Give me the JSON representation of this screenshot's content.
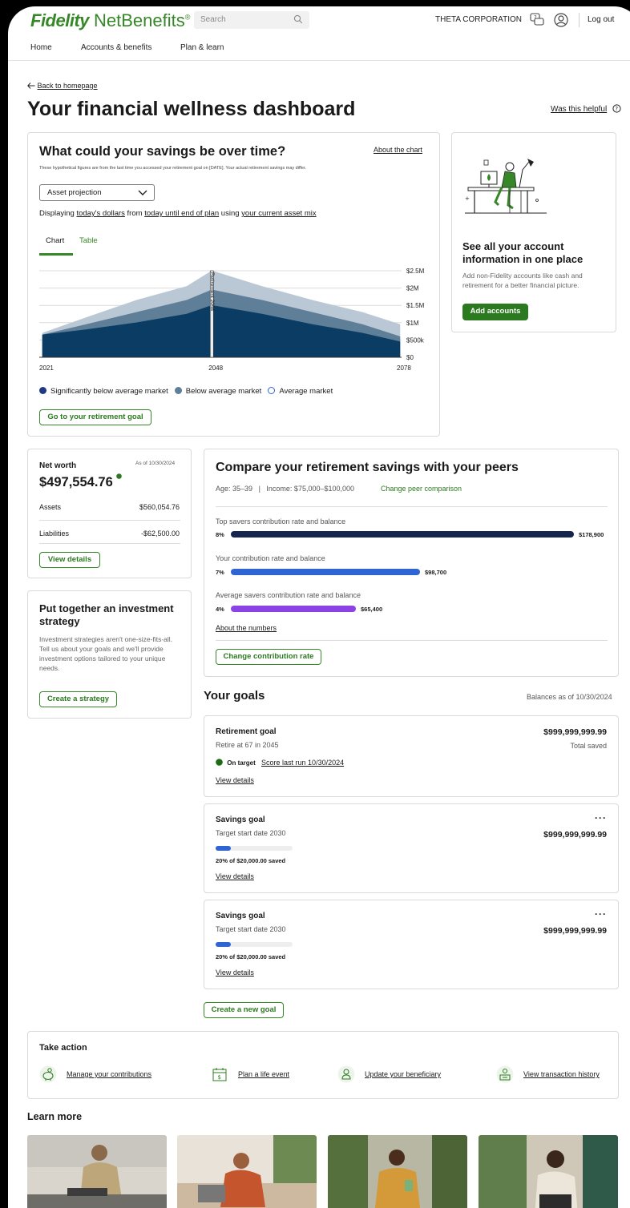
{
  "header": {
    "logo_brand": "Fidelity",
    "logo_product": "NetBenefits",
    "logo_mark": "®",
    "search_placeholder": "Search",
    "company": "THETA CORPORATION",
    "logout": "Log out"
  },
  "nav": [
    "Home",
    "Accounts & benefits",
    "Plan & learn"
  ],
  "page": {
    "back_link": "Back to homepage",
    "title": "Your financial wellness dashboard",
    "helpful": "Was this helpful"
  },
  "projection": {
    "title": "What could your savings be over time?",
    "about": "About the chart",
    "subtitle": "These hypothetical figures are from the last time you accessed your retirement goal on [DATE]. Your actual retirement savings may differ.",
    "select_value": "Asset projection",
    "displaying_prefix": "Displaying",
    "displaying_dollars": "today's dollars",
    "displaying_from": "from",
    "displaying_range": "today until end of plan",
    "displaying_using": "using",
    "displaying_mix": "your current asset mix",
    "tab_chart": "Chart",
    "tab_table": "Table",
    "cta": "Go to your retirement goal"
  },
  "chart_data": {
    "type": "area",
    "x_ticks": [
      "2021",
      "2048",
      "2078"
    ],
    "y_ticks": [
      "$2.5M",
      "$2M",
      "$1.5M",
      "$1M",
      "$500k",
      "$0"
    ],
    "ylim": [
      0,
      2500000
    ],
    "xlim": [
      2021,
      2078
    ],
    "marker_label": "Retirement 2048",
    "marker_x": 2048,
    "x": [
      2021,
      2028,
      2036,
      2044,
      2048,
      2056,
      2064,
      2072,
      2078
    ],
    "series": [
      {
        "name": "Average market",
        "color": "#b9c8d4",
        "values": [
          700000,
          1150000,
          1650000,
          2050000,
          2500000,
          2050000,
          1650000,
          1300000,
          950000
        ]
      },
      {
        "name": "Below average market",
        "color": "#5f7e98",
        "values": [
          650000,
          950000,
          1300000,
          1650000,
          1950000,
          1650000,
          1300000,
          950000,
          600000
        ]
      },
      {
        "name": "Significantly below average market",
        "color": "#0b3c63",
        "values": [
          650000,
          800000,
          1000000,
          1250000,
          1500000,
          1250000,
          950000,
          700000,
          450000
        ]
      }
    ],
    "legend": [
      {
        "label": "Significantly below average market",
        "color": "#1f3a82",
        "filled": true
      },
      {
        "label": "Below average market",
        "color": "#5f7e98",
        "filled": true
      },
      {
        "label": "Average market",
        "color": "#2f64d4",
        "filled": false
      }
    ],
    "grid": true
  },
  "promo": {
    "title": "See all your account information in one place",
    "text": "Add non-Fidelity accounts like cash and retirement for a better financial picture.",
    "button": "Add accounts"
  },
  "networth": {
    "label": "Net worth",
    "asof": "As of 10/30/2024",
    "value": "$497,554.76",
    "assets_label": "Assets",
    "assets_value": "$560,054.76",
    "liabilities_label": "Liabilities",
    "liabilities_value": "-$62,500.00",
    "button": "View details"
  },
  "strategy": {
    "title": "Put together an investment strategy",
    "text": "Investment strategies aren't one-size-fits-all. Tell us about your goals and we'll provide investment options tailored to your unique needs.",
    "button": "Create a strategy"
  },
  "peers": {
    "title": "Compare your retirement savings with your peers",
    "age": "Age: 35–39",
    "separator": "|",
    "income": "Income: $75,000–$100,000",
    "change": "Change peer comparison",
    "rows": [
      {
        "label": "Top savers contribution rate and balance",
        "rate": "8%",
        "balance": "$178,900",
        "value": 178900,
        "color": "#14264f"
      },
      {
        "label": "Your contribution rate and balance",
        "rate": "7%",
        "balance": "$98,700",
        "value": 98700,
        "color": "#2f64d4"
      },
      {
        "label": "Average savers contribution rate and balance",
        "rate": "4%",
        "balance": "$65,400",
        "value": 65400,
        "color": "#8c43e6"
      }
    ],
    "about": "About the numbers",
    "button": "Change contribution rate"
  },
  "goals": {
    "title": "Your goals",
    "asof": "Balances as of 10/30/2024",
    "retirement": {
      "name": "Retirement goal",
      "sub": "Retire at 67 in 2045",
      "amount": "$999,999,999.99",
      "amount_label": "Total saved",
      "status": "On target",
      "score": "Score last run 10/30/2024",
      "link": "View details"
    },
    "savings": [
      {
        "name": "Savings goal",
        "sub": "Target start date 2030",
        "amount": "$999,999,999.99",
        "progress": 0.2,
        "progress_text": "20% of $20,000.00 saved",
        "link": "View details",
        "more": "···"
      },
      {
        "name": "Savings goal",
        "sub": "Target start date 2030",
        "amount": "$999,999,999.99",
        "progress": 0.2,
        "progress_text": "20% of $20,000.00 saved",
        "link": "View details",
        "more": "···"
      }
    ],
    "create": "Create a new goal"
  },
  "take_action": {
    "title": "Take action",
    "items": [
      "Manage your contributions",
      "Plan a life event",
      "Update your beneficiary",
      "View transaction history"
    ]
  },
  "learn_more": {
    "title": "Learn more"
  },
  "colors": {
    "brand": "#368727",
    "button": "#2c7a20"
  }
}
